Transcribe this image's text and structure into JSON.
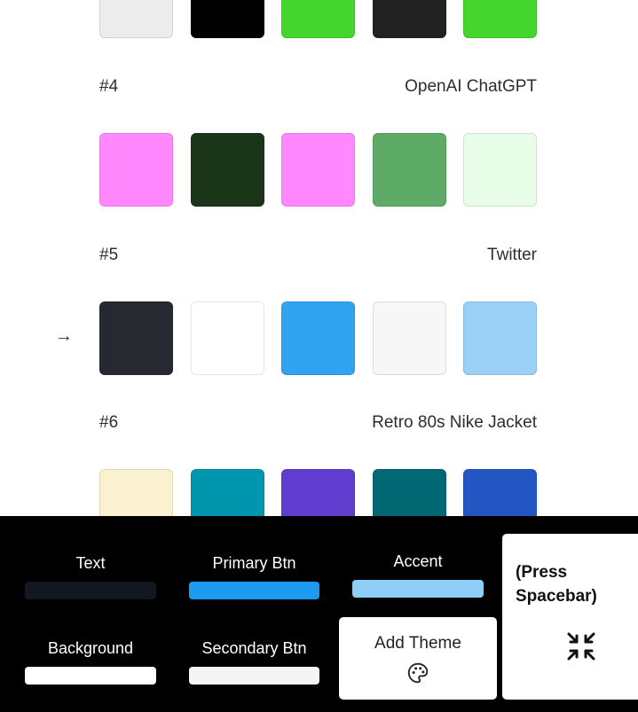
{
  "themes": [
    {
      "number": "",
      "name": "",
      "colors": [
        "#ececec",
        "#000000",
        "#44d62c",
        "#222222",
        "#44d62c"
      ]
    },
    {
      "number": "#4",
      "name": "OpenAI ChatGPT",
      "colors": [
        "#ff88ff",
        "#1a3518",
        "#ff88ff",
        "#5dab67",
        "#e8fde8"
      ]
    },
    {
      "number": "#5",
      "name": "Twitter",
      "colors": [
        "#262a30",
        "#ffffff",
        "#32a3f0",
        "#f7f7f7",
        "#9bd0f7"
      ]
    },
    {
      "number": "#6",
      "name": "Retro 80s Nike Jacket",
      "colors": [
        "#faf1d1",
        "#0096ad",
        "#5e3dcf",
        "#016773",
        "#2356c3"
      ]
    }
  ],
  "current_marker": "→",
  "palette": {
    "text": {
      "label": "Text",
      "color": "#131820"
    },
    "primary_btn": {
      "label": "Primary Btn",
      "color": "#1d9bf0"
    },
    "accent": {
      "label": "Accent",
      "color": "#8ecdf8"
    },
    "background": {
      "label": "Background",
      "color": "#ffffff"
    },
    "secondary_btn": {
      "label": "Secondary Btn",
      "color": "#f5f5f5"
    }
  },
  "add_theme": {
    "label": "Add Theme",
    "icon": "palette-icon"
  },
  "spacebar": {
    "hint": "(Press Spacebar)",
    "icon": "shuffle-arrows-icon"
  }
}
